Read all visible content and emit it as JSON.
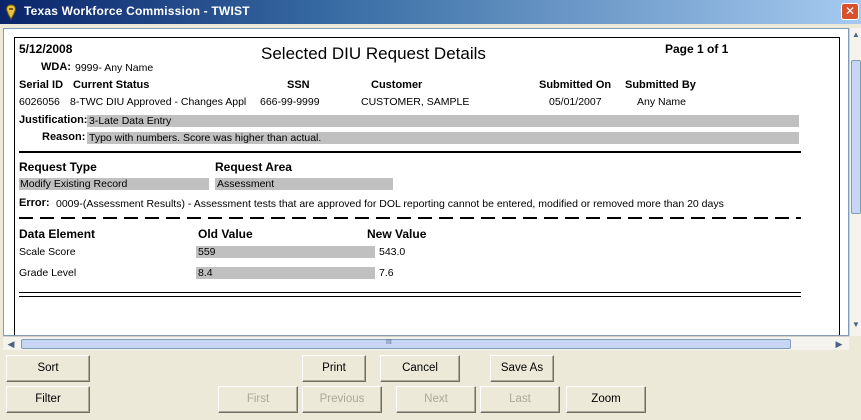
{
  "window": {
    "title": "Texas Workforce Commission - TWIST",
    "close_label": "✕"
  },
  "report": {
    "date": "5/12/2008",
    "title": "Selected DIU Request Details",
    "page": "Page 1 of 1",
    "wda_label": "WDA:",
    "wda_value": "9999- Any Name",
    "columns": {
      "serial_id": "Serial ID",
      "current_status": "Current Status",
      "ssn": "SSN",
      "customer": "Customer",
      "submitted_on": "Submitted On",
      "submitted_by": "Submitted By"
    },
    "row": {
      "serial_id": "6026056",
      "current_status": "8-TWC DIU Approved - Changes Appl",
      "ssn": "666-99-9999",
      "customer": "CUSTOMER, SAMPLE",
      "submitted_on": "05/01/2007",
      "submitted_by": "Any Name"
    },
    "justification_label": "Justification:",
    "justification_value": "3-Late Data Entry",
    "reason_label": "Reason:",
    "reason_value": "Typo with numbers.  Score was higher than actual.",
    "request_type_label": "Request Type",
    "request_area_label": "Request Area",
    "request_type_value": "Modify Existing Record",
    "request_area_value": "Assessment",
    "error_label": "Error:",
    "error_value": "0009-(Assessment Results) - Assessment tests that are approved for DOL reporting cannot be entered, modified or removed more than 20 days",
    "data_columns": {
      "element": "Data Element",
      "old": "Old Value",
      "new": "New Value"
    },
    "data_rows": [
      {
        "element": "Scale Score",
        "old": "559",
        "new": "543.0"
      },
      {
        "element": "Grade Level",
        "old": "8.4",
        "new": "7.6"
      }
    ]
  },
  "scrollbar": {
    "grip": "III"
  },
  "buttons": {
    "sort": "Sort",
    "print": "Print",
    "cancel": "Cancel",
    "save_as": "Save As",
    "filter": "Filter",
    "first": "First",
    "previous": "Previous",
    "next": "Next",
    "last": "Last",
    "zoom": "Zoom"
  }
}
